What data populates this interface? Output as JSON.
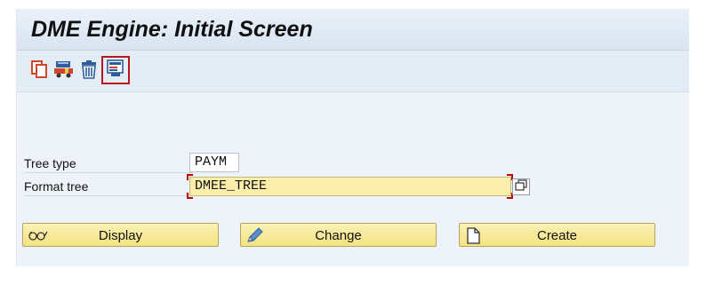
{
  "window": {
    "title": "DME Engine: Initial Screen"
  },
  "toolbar": {
    "buttons": [
      {
        "icon": "copy-icon"
      },
      {
        "icon": "transport-icon"
      },
      {
        "icon": "delete-icon"
      },
      {
        "icon": "tree-structure-icon"
      }
    ]
  },
  "form": {
    "tree_type": {
      "label": "Tree type",
      "value": "PAYM"
    },
    "format_tree": {
      "label": "Format tree",
      "value": "DMEE_TREE"
    }
  },
  "actions": {
    "display": "Display",
    "change": "Change",
    "create": "Create"
  },
  "colors": {
    "highlight": "#b4171c",
    "required_field": "#fbeeab",
    "button": "#f8ea9c"
  }
}
